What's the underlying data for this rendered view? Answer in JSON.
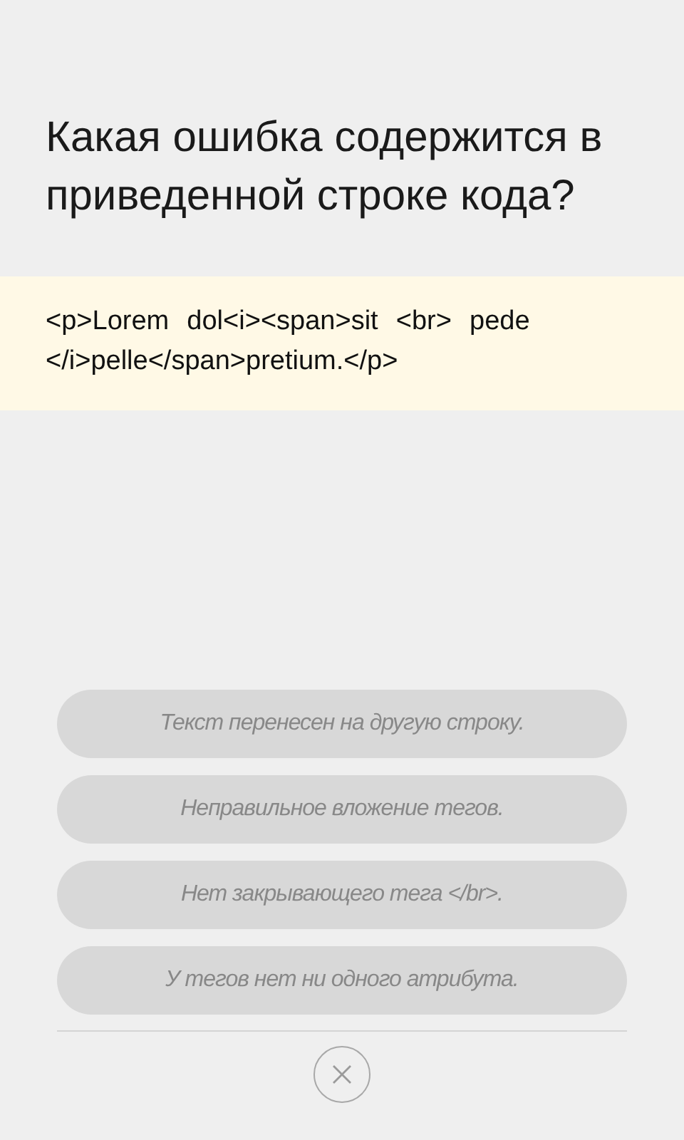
{
  "question": "Какая ошибка содержится в приведенной строке кода?",
  "code": "<p>Lorem  dol<i><span>sit  <br>  pede </i>pelle</span>pretium.</p>",
  "answers": [
    "Текст перенесен на другую строку.",
    "Неправильное вложение тегов.",
    "Нет закрывающего тега </br>.",
    "У тегов нет ни одного атрибута."
  ]
}
